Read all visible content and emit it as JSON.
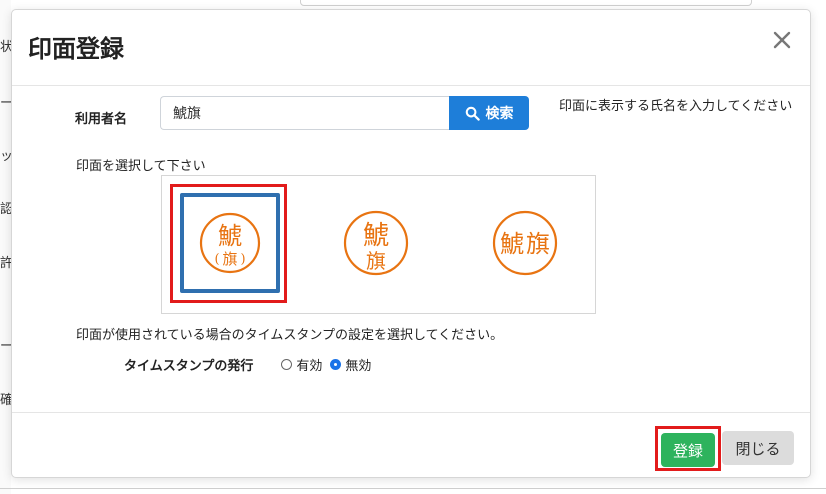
{
  "modal": {
    "title": "印面登録",
    "close_icon": "close-x-icon"
  },
  "user": {
    "label": "利用者名",
    "value": "鯱旗",
    "search_label": "検索",
    "search_icon": "magnifier-icon",
    "hint": "印面に表示する氏名を入力してください"
  },
  "stamps": {
    "prompt": "印面を選択して下さい",
    "options": [
      {
        "chars": [
          "鯱",
          "旗"
        ],
        "style": "large-top-small-bottom-parenthesized",
        "selected": true
      },
      {
        "chars": [
          "鯱",
          "旗"
        ],
        "style": "stacked-vertical",
        "selected": false
      },
      {
        "chars": [
          "鯱",
          "旗"
        ],
        "style": "side-by-side",
        "selected": false
      }
    ],
    "color": "#e87412"
  },
  "timestamp": {
    "description": "印面が使用されている場合のタイムスタンプの設定を選択してください。",
    "label": "タイムスタンプの発行",
    "options": [
      {
        "label": "有効",
        "checked": false
      },
      {
        "label": "無効",
        "checked": true
      }
    ]
  },
  "footer": {
    "register_label": "登録",
    "close_label": "閉じる"
  },
  "background": {
    "left_fragments": [
      "状",
      "ー",
      "ッ",
      "認",
      "許",
      "ー",
      "確"
    ]
  },
  "colors": {
    "primary": "#1e7ed9",
    "success": "#2db35d",
    "highlight": "#e21b1b",
    "selected_border": "#2f6faf"
  }
}
